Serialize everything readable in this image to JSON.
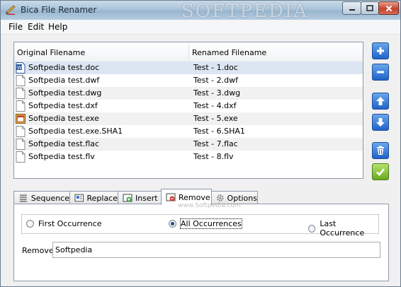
{
  "window": {
    "title": "Bica File Renamer",
    "watermark": "SOFTPEDIA",
    "watermark_small": "www.Softpedia.com"
  },
  "menu": [
    "File",
    "Edit",
    "Help"
  ],
  "file_list": {
    "columns": [
      "Original Filename",
      "Renamed Filename"
    ],
    "rows": [
      {
        "original": "Softpedia test.doc",
        "renamed": "Test - 1.doc",
        "icon": "word-doc-icon",
        "selected": true
      },
      {
        "original": "Softpedia test.dwf",
        "renamed": "Test - 2.dwf",
        "icon": "file-icon"
      },
      {
        "original": "Softpedia test.dwg",
        "renamed": "Test - 3.dwg",
        "icon": "file-icon"
      },
      {
        "original": "Softpedia test.dxf",
        "renamed": "Test - 4.dxf",
        "icon": "file-icon"
      },
      {
        "original": "Softpedia test.exe",
        "renamed": "Test - 5.exe",
        "icon": "exe-icon"
      },
      {
        "original": "Softpedia test.exe.SHA1",
        "renamed": "Test - 6.SHA1",
        "icon": "file-icon"
      },
      {
        "original": "Softpedia test.flac",
        "renamed": "Test - 7.flac",
        "icon": "file-icon"
      },
      {
        "original": "Softpedia test.flv",
        "renamed": "Test - 8.flv",
        "icon": "file-icon"
      }
    ]
  },
  "side_buttons": [
    "add-icon",
    "remove-icon",
    "move-up-icon",
    "move-down-icon",
    "trash-icon",
    "apply-check-icon"
  ],
  "tabs": [
    {
      "label": "Sequence",
      "icon": "sequence-icon"
    },
    {
      "label": "Replace",
      "icon": "replace-icon"
    },
    {
      "label": "Insert",
      "icon": "insert-icon"
    },
    {
      "label": "Remove",
      "icon": "remove-tab-icon",
      "active": true
    },
    {
      "label": "Options",
      "icon": "gear-icon"
    }
  ],
  "remove_panel": {
    "options": [
      "First Occurrence",
      "All Occurrences",
      "Last Occurrence"
    ],
    "selected_option": "All Occurrences",
    "remove_label": "Remove",
    "remove_value": "Softpedia"
  },
  "colors": {
    "selected_row": "#dce6f3",
    "accent_blue": "#1e63c8",
    "accent_green": "#6aa822"
  }
}
